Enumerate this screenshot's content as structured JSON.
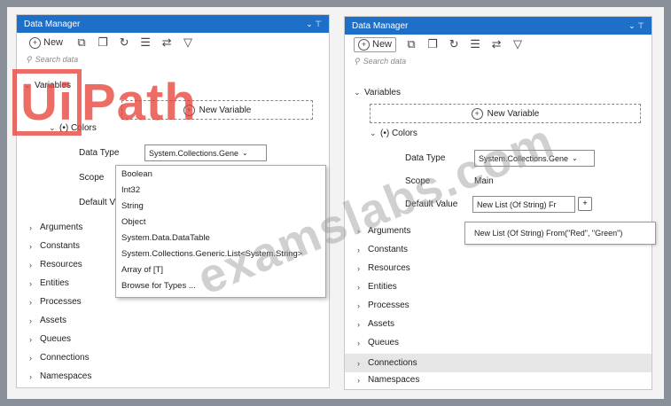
{
  "left_panel": {
    "title": "Data Manager",
    "controls": "⌄ ⊤",
    "new_label": "New",
    "search_placeholder": "Search data",
    "variables_label": "Variables",
    "new_variable_label": "New Variable",
    "colors_label": "(•)  Colors",
    "data_type_label": "Data Type",
    "data_type_value": "System.Collections.Gene",
    "scope_label": "Scope",
    "default_label": "Default V",
    "sections": [
      "Arguments",
      "Constants",
      "Resources",
      "Entities",
      "Processes",
      "Assets",
      "Queues",
      "Connections",
      "Namespaces"
    ]
  },
  "dropdown_options": [
    "Boolean",
    "Int32",
    "String",
    "Object",
    "System.Data.DataTable",
    "System.Collections.Generic.List<System.String>",
    "Array of [T]",
    "Browse for Types ..."
  ],
  "right_panel": {
    "title": "Data Manager",
    "controls": "⌄ ⊤",
    "new_label": "New",
    "search_placeholder": "Search data",
    "variables_label": "Variables",
    "new_variable_label": "New Variable",
    "colors_label": "(•)  Colors",
    "data_type_label": "Data Type",
    "data_type_value": "System.Collections.Gene",
    "scope_label": "Scope",
    "scope_value": "Main",
    "default_label": "Default Value",
    "default_value": "New List (Of String) Fr",
    "tooltip": "New List (Of String) From(\"Red\", \"Green\")",
    "sections": [
      "Arguments",
      "Constants",
      "Resources",
      "Entities",
      "Processes",
      "Assets",
      "Queues",
      "Connections",
      "Namespaces"
    ],
    "highlighted_section": "Connections"
  },
  "overlay": {
    "logo_ui": "Ui",
    "logo_path": "Path",
    "watermark": "examslabs.com"
  }
}
